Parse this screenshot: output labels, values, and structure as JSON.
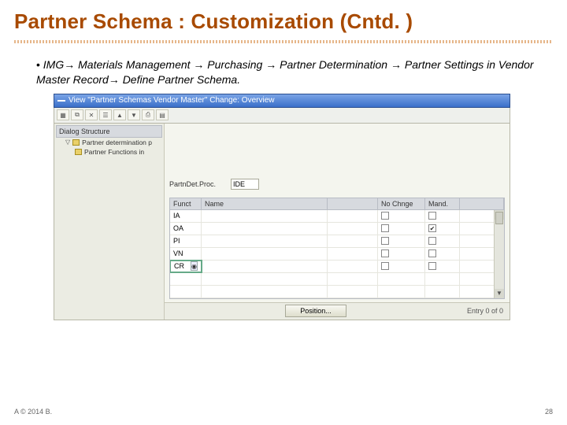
{
  "slide": {
    "title": "Partner Schema : Customization (Cntd. )",
    "bullet": "IMG→ Materials Management → Purchasing → Partner Determination → Partner Settings in Vendor Master Record→ Define Partner Schema.",
    "footer_left": "A © 2014 B.",
    "page_number": "28"
  },
  "sap": {
    "window_title": "View \"Partner Schemas Vendor Master\" Change: Overview",
    "toolbar_icons": [
      "new",
      "copy",
      "delete",
      "select",
      "up",
      "down",
      "print",
      "table"
    ],
    "tree": {
      "header": "Dialog Structure",
      "items": [
        {
          "label": "Partner determination p"
        },
        {
          "label": "Partner Functions in"
        }
      ]
    },
    "field": {
      "label": "PartnDet.Proc.",
      "value": "IDE"
    },
    "grid": {
      "headers": {
        "funct": "Funct",
        "name": "Name",
        "mid": "",
        "nochg": "No Chnge",
        "mand": "Mand."
      },
      "rows": [
        {
          "funct": "IA",
          "nochg": false,
          "mand": false
        },
        {
          "funct": "OA",
          "nochg": false,
          "mand": true
        },
        {
          "funct": "PI",
          "nochg": false,
          "mand": false
        },
        {
          "funct": "VN",
          "nochg": false,
          "mand": false
        },
        {
          "funct": "CR",
          "nochg": false,
          "mand": false,
          "f4": true
        }
      ]
    },
    "position": {
      "button": "Position...",
      "entry_text": "Entry 0 of 0"
    }
  }
}
